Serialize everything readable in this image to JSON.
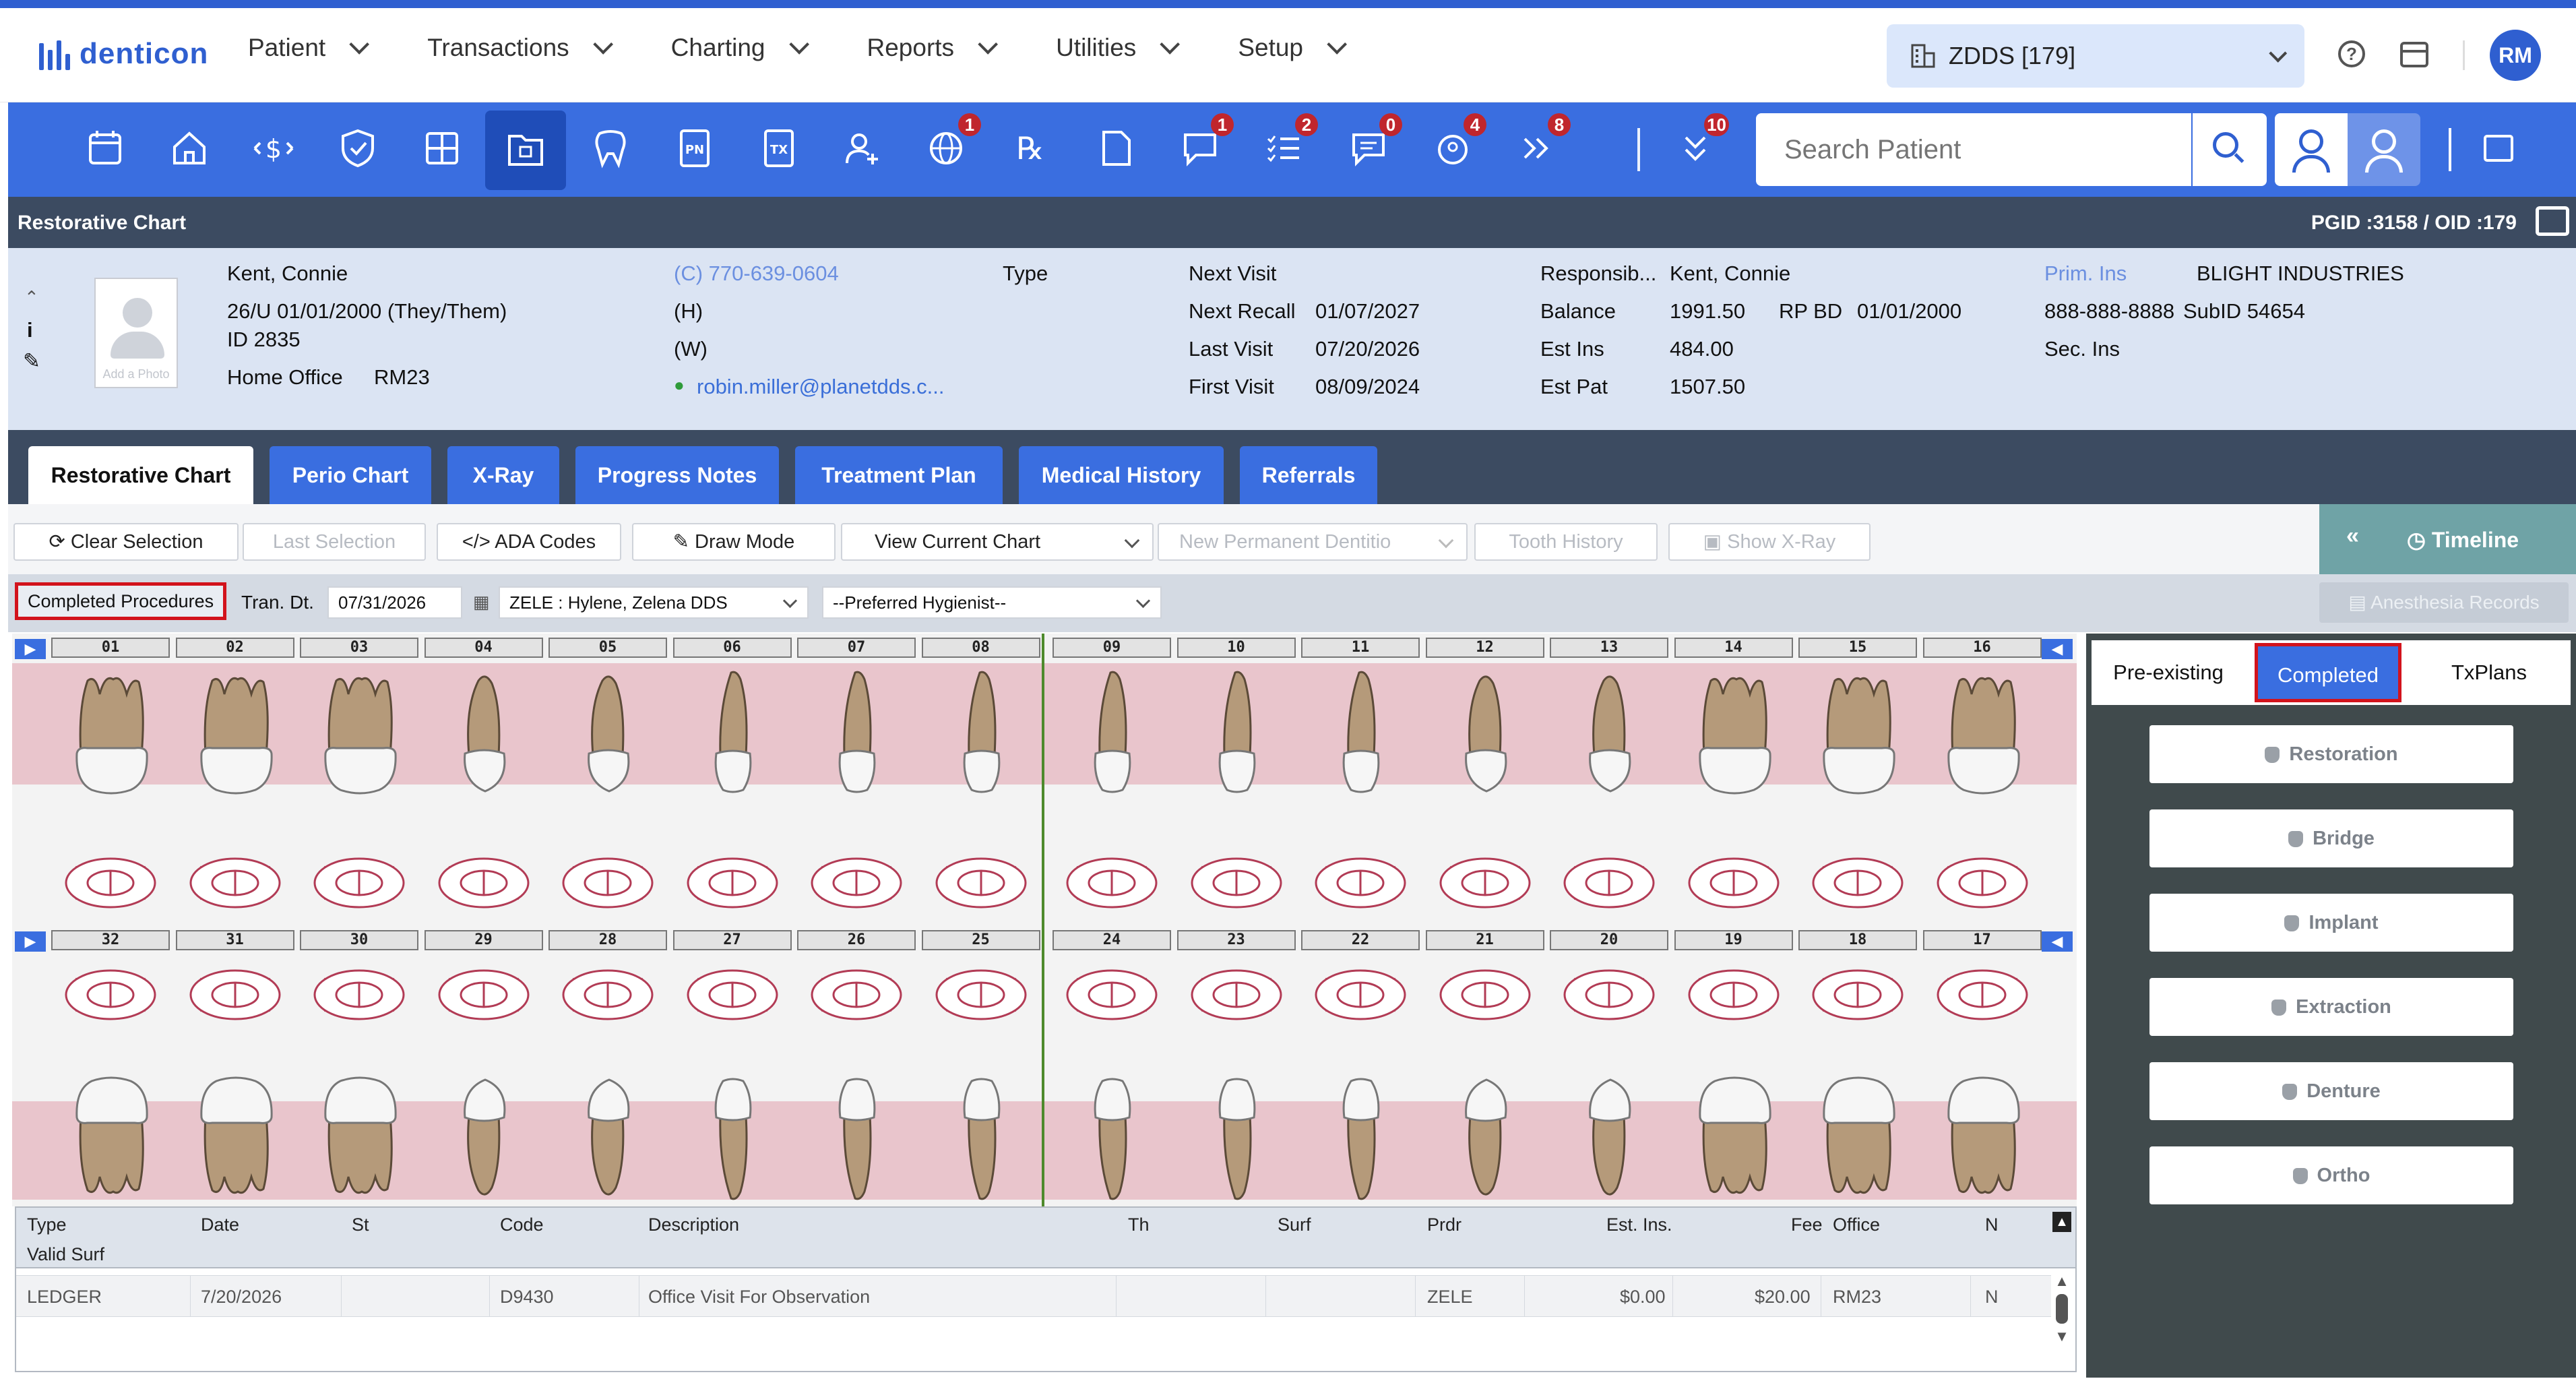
{
  "app": {
    "logo_text": "denticon",
    "brand_color": "#2f5fd0"
  },
  "menu": [
    {
      "label": "Patient"
    },
    {
      "label": "Transactions"
    },
    {
      "label": "Charting"
    },
    {
      "label": "Reports"
    },
    {
      "label": "Utilities"
    },
    {
      "label": "Setup"
    }
  ],
  "office": {
    "label": "ZDDS [179]"
  },
  "user": {
    "initials": "RM"
  },
  "toolbar": {
    "badges": {
      "b1": "1",
      "b2": "1",
      "b3": "2",
      "b4": "0",
      "b5": "4",
      "b6": "8",
      "b7": "10"
    },
    "search_placeholder": "Search Patient"
  },
  "titlebar": {
    "title": "Restorative Chart",
    "ids": "PGID :3158  /  OID :179"
  },
  "patient": {
    "name": "Kent, Connie",
    "demo": "26/U   01/01/2000   (They/Them)",
    "id": "ID 2835",
    "home_office_label": "Home Office",
    "home_office": "RM23",
    "photo_caption": "Add a Photo",
    "phone_c": "(C)  770-639-0604",
    "phone_h": "(H)",
    "phone_w": "(W)",
    "email": "robin.miller@planetdds.c...",
    "type_label": "Type",
    "next_visit_label": "Next Visit",
    "next_recall_label": "Next Recall",
    "next_recall": "01/07/2027",
    "last_visit_label": "Last Visit",
    "last_visit": "07/20/2026",
    "first_visit_label": "First Visit",
    "first_visit": "08/09/2024",
    "resp_label": "Responsib...",
    "resp": "Kent, Connie",
    "balance_label": "Balance",
    "balance": "1991.50",
    "rp_bd_label": "RP BD",
    "rp_bd": "01/01/2000",
    "est_ins_label": "Est Ins",
    "est_ins": "484.00",
    "est_pat_label": "Est Pat",
    "est_pat": "1507.50",
    "prim_ins_label": "Prim. Ins",
    "prim_ins": "BLIGHT INDUSTRIES",
    "ins_phone": "888-888-8888",
    "subid": "SubID  54654",
    "sec_ins_label": "Sec. Ins"
  },
  "tabs": [
    {
      "label": "Restorative Chart"
    },
    {
      "label": "Perio Chart"
    },
    {
      "label": "X-Ray"
    },
    {
      "label": "Progress Notes"
    },
    {
      "label": "Treatment Plan"
    },
    {
      "label": "Medical History"
    },
    {
      "label": "Referrals"
    }
  ],
  "actions": {
    "clear_selection": "Clear Selection",
    "last_selection": "Last Selection",
    "ada_codes": "ADA Codes",
    "draw_mode": "Draw Mode",
    "view_current_chart": "View Current Chart",
    "new_permanent": "New Permanent Dentitio",
    "tooth_history": "Tooth History",
    "show_xray": "Show X-Ray",
    "timeline": "Timeline"
  },
  "filter": {
    "completed_procedures": "Completed Procedures",
    "tran_dt_label": "Tran. Dt.",
    "tran_dt": "07/31/2026",
    "provider": "ZELE : Hylene, Zelena DDS",
    "hygienist": "--Preferred Hygienist--",
    "anesthesia": "Anesthesia Records"
  },
  "teeth_upper": [
    "01",
    "02",
    "03",
    "04",
    "05",
    "06",
    "07",
    "08",
    "09",
    "10",
    "11",
    "12",
    "13",
    "14",
    "15",
    "16"
  ],
  "teeth_lower": [
    "32",
    "31",
    "30",
    "29",
    "28",
    "27",
    "26",
    "25",
    "24",
    "23",
    "22",
    "21",
    "20",
    "19",
    "18",
    "17"
  ],
  "right_panel": {
    "tabs": [
      {
        "label": "Pre-existing"
      },
      {
        "label": "Completed"
      },
      {
        "label": "TxPlans"
      }
    ],
    "buttons": [
      {
        "label": "Restoration"
      },
      {
        "label": "Bridge"
      },
      {
        "label": "Implant"
      },
      {
        "label": "Extraction"
      },
      {
        "label": "Denture"
      },
      {
        "label": "Ortho"
      }
    ]
  },
  "grid": {
    "headers": {
      "type": "Type",
      "date": "Date",
      "st": "St",
      "code": "Code",
      "description": "Description",
      "th": "Th",
      "surf": "Surf",
      "prdr": "Prdr",
      "est_ins": "Est. Ins.",
      "fee": "Fee",
      "office": "Office",
      "n": "N"
    },
    "subheader": "Valid Surf",
    "rows": [
      {
        "type": "LEDGER",
        "date": "7/20/2026",
        "st": "",
        "code": "D9430",
        "description": "Office Visit For Observation",
        "th": "",
        "surf": "",
        "prdr": "ZELE",
        "est_ins": "$0.00",
        "fee": "$20.00",
        "office": "RM23",
        "n": "N"
      }
    ]
  }
}
